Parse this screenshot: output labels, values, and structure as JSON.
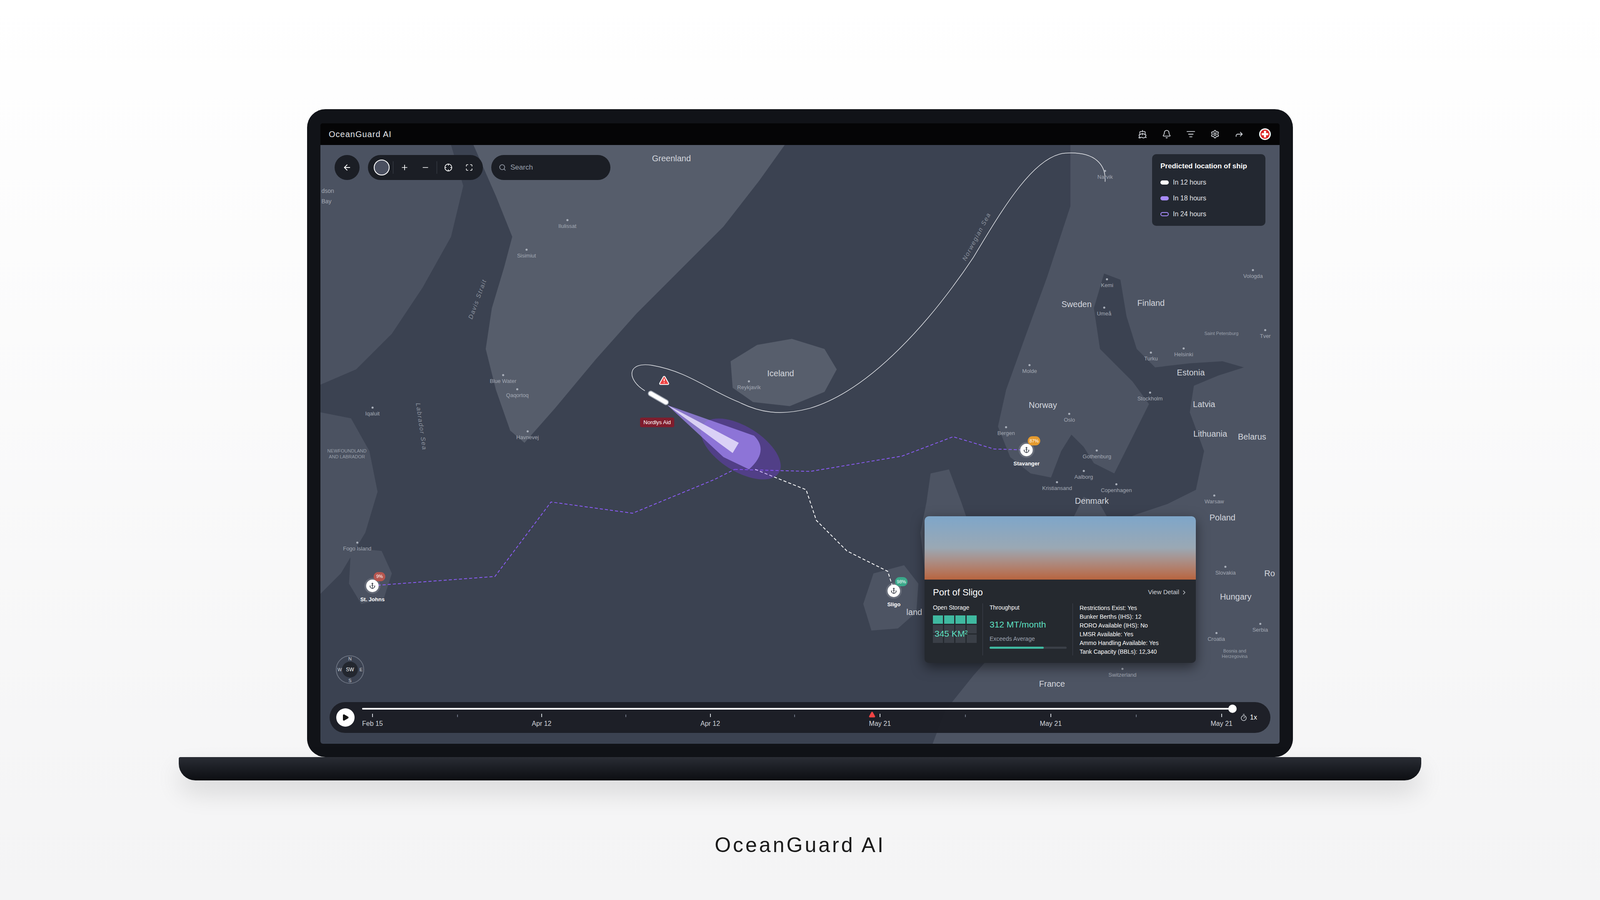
{
  "app": {
    "title": "OceanGuard AI"
  },
  "toolbar": {
    "search_placeholder": "Search"
  },
  "legend": {
    "title": "Predicted location of ship",
    "items": [
      {
        "label": "In 12 hours",
        "kind": "filled",
        "color": "#ffffff"
      },
      {
        "label": "In 18 hours",
        "kind": "filled",
        "color": "#a78bfa"
      },
      {
        "label": "In 24 hours",
        "kind": "outline",
        "color": "#a78bfa"
      }
    ]
  },
  "map": {
    "labels": [
      {
        "text": "Greenland",
        "kind": "country"
      },
      {
        "text": "Iceland",
        "kind": "country"
      },
      {
        "text": "Sweden",
        "kind": "country"
      },
      {
        "text": "Finland",
        "kind": "country"
      },
      {
        "text": "Norway",
        "kind": "country"
      },
      {
        "text": "Estonia",
        "kind": "country"
      },
      {
        "text": "Latvia",
        "kind": "country"
      },
      {
        "text": "Lithuania",
        "kind": "country"
      },
      {
        "text": "Belarus",
        "kind": "country"
      },
      {
        "text": "Denmark",
        "kind": "country"
      },
      {
        "text": "Poland",
        "kind": "country"
      },
      {
        "text": "Hungary",
        "kind": "country"
      },
      {
        "text": "France",
        "kind": "country"
      },
      {
        "text": "land",
        "kind": "country"
      },
      {
        "text": "Davis Strait",
        "kind": "sea"
      },
      {
        "text": "Labrador Sea",
        "kind": "sea"
      },
      {
        "text": "Norwegian Sea",
        "kind": "sea"
      },
      {
        "text": "Ilulissat",
        "kind": "city"
      },
      {
        "text": "Sisimiut",
        "kind": "city"
      },
      {
        "text": "Blue Water",
        "kind": "city"
      },
      {
        "text": "Qaqortoq",
        "kind": "city"
      },
      {
        "text": "Havnevej",
        "kind": "city"
      },
      {
        "text": "Iqaluit",
        "kind": "city"
      },
      {
        "text": "NEWFOUNDLAND AND LABRADOR",
        "kind": "region"
      },
      {
        "text": "Fogo Island",
        "kind": "city"
      },
      {
        "text": "Reykjavík",
        "kind": "city"
      },
      {
        "text": "Narvik",
        "kind": "city"
      },
      {
        "text": "Kemi",
        "kind": "city"
      },
      {
        "text": "Umeå",
        "kind": "city"
      },
      {
        "text": "Vologda",
        "kind": "city"
      },
      {
        "text": "Saint Petersburg",
        "kind": "region"
      },
      {
        "text": "Tver",
        "kind": "city"
      },
      {
        "text": "Turku",
        "kind": "city"
      },
      {
        "text": "Helsinki",
        "kind": "city"
      },
      {
        "text": "Molde",
        "kind": "city"
      },
      {
        "text": "Stockholm",
        "kind": "city"
      },
      {
        "text": "Bergen",
        "kind": "city"
      },
      {
        "text": "Oslo",
        "kind": "city"
      },
      {
        "text": "Gothenburg",
        "kind": "city"
      },
      {
        "text": "Aalborg",
        "kind": "city"
      },
      {
        "text": "Kristiansand",
        "kind": "city"
      },
      {
        "text": "Copenhagen",
        "kind": "city"
      },
      {
        "text": "Warsaw",
        "kind": "city"
      },
      {
        "text": "Slovakia",
        "kind": "city"
      },
      {
        "text": "Serbia",
        "kind": "city"
      },
      {
        "text": "Croatia",
        "kind": "city"
      },
      {
        "text": "Bosnia and Herzegovina",
        "kind": "region"
      },
      {
        "text": "Switzerland",
        "kind": "city"
      },
      {
        "text": "dson",
        "kind": "edge-city"
      },
      {
        "text": "Bay",
        "kind": "edge-city"
      },
      {
        "text": "Ro",
        "kind": "edge-country"
      }
    ]
  },
  "ship": {
    "name": "Nordlys Aid",
    "alert": true
  },
  "ports": [
    {
      "name": "St. Johns",
      "badge": "9%",
      "color": "#b5564f"
    },
    {
      "name": "Sligo",
      "badge": "98%",
      "color": "#3aa88a"
    },
    {
      "name": "Stavanger",
      "badge": "87%",
      "color": "#e49a2e"
    }
  ],
  "compass": {
    "n": "N",
    "e": "E",
    "s": "S",
    "w": "W",
    "heading": "SW"
  },
  "port_card": {
    "title": "Port of Sligo",
    "link": "View Detail",
    "open_storage": {
      "label": "Open Storage",
      "value": "345 KM²",
      "cells": [
        {
          "filled": true
        },
        {
          "filled": true
        },
        {
          "filled": true
        },
        {
          "filled": true
        },
        {
          "filled": false
        },
        {
          "filled": false
        },
        {
          "filled": false
        },
        {
          "filled": false
        },
        {
          "filled": false
        },
        {
          "filled": false
        },
        {
          "filled": false
        },
        {
          "filled": false
        }
      ]
    },
    "throughput": {
      "label": "Throughput",
      "value": "312 MT/month",
      "note": "Exceeds Average",
      "level": 0.7
    },
    "facts": [
      "Restrictions Exist: Yes",
      "Bunker Berths (IHS): 12",
      "RORO Available (IHS): No",
      "LMSR Available: Yes",
      "Ammo Handling Available: Yes",
      "Tank Capacity (BBLs): 12,340"
    ]
  },
  "timeline": {
    "playing": false,
    "level": 1,
    "speed": "1x",
    "ticks": [
      {
        "label": "Feb 15",
        "alert": false
      },
      {
        "label": "Apr 12",
        "alert": false
      },
      {
        "label": "Apr 12",
        "alert": false
      },
      {
        "label": "May 21",
        "alert": true
      },
      {
        "label": "May 21",
        "alert": false
      },
      {
        "label": "May 21",
        "alert": false
      }
    ]
  },
  "caption": "OceanGuard AI"
}
